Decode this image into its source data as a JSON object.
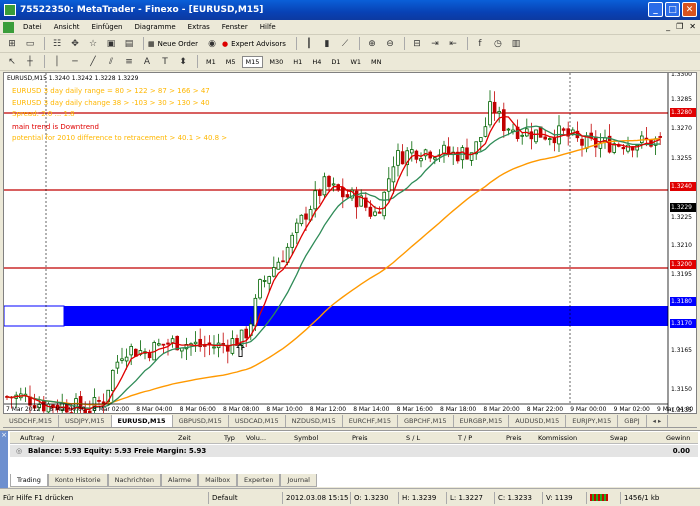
{
  "window": {
    "title": "75522350: MetaTrader - Finexo - [EURUSD,M15]"
  },
  "menu": [
    "Datei",
    "Ansicht",
    "Einfügen",
    "Diagramme",
    "Extras",
    "Fenster",
    "Hilfe"
  ],
  "toolbar": {
    "new_order": "Neue Order",
    "expert_advisors": "Expert Advisors"
  },
  "timeframes": [
    "M1",
    "M5",
    "M15",
    "M30",
    "H1",
    "H4",
    "D1",
    "W1",
    "MN"
  ],
  "active_timeframe": "M15",
  "chart": {
    "symbol_header": "EURUSD,M15  1.3240 1.3242 1.3228 1.3229",
    "info_lines": [
      {
        "text": "EURUSD 3 day daily range = 80 > 122 > 87 > 166 > 47",
        "color": "yellow"
      },
      {
        "text": "EURUSD 3 day daily change  38 > -103 > 30 > 130 > 40",
        "color": "yellow"
      },
      {
        "text": "Spread: 2.0 ... 1.8",
        "color": "yellow"
      },
      {
        "text": "main trend is Downtrend",
        "color": "red"
      },
      {
        "text": "potential for 2010 difference to retracement > 40.1 > 40.8 >",
        "color": "yellow"
      }
    ],
    "price_labels": [
      {
        "text": "1.3300",
        "style": "plain"
      },
      {
        "text": "1.3285",
        "style": "plain"
      },
      {
        "text": "1.3280",
        "style": "red"
      },
      {
        "text": "1.3270",
        "style": "plain"
      },
      {
        "text": "1.3255",
        "style": "plain"
      },
      {
        "text": "1.3240",
        "style": "red"
      },
      {
        "text": "1.3229",
        "style": "black"
      },
      {
        "text": "1.3225",
        "style": "plain"
      },
      {
        "text": "1.3210",
        "style": "plain"
      },
      {
        "text": "1.3200",
        "style": "red"
      },
      {
        "text": "1.3195",
        "style": "plain"
      },
      {
        "text": "1.3180",
        "style": "blue"
      },
      {
        "text": "1.3170",
        "style": "blue"
      },
      {
        "text": "1.3165",
        "style": "plain"
      },
      {
        "text": "1.3150",
        "style": "plain"
      },
      {
        "text": "1.3135",
        "style": "plain"
      }
    ],
    "time_labels": [
      "7 Mar 2012",
      "8 Mar 00:00",
      "8 Mar 02:00",
      "8 Mar 04:00",
      "8 Mar 06:00",
      "8 Mar 08:00",
      "8 Mar 10:00",
      "8 Mar 12:00",
      "8 Mar 14:00",
      "8 Mar 16:00",
      "8 Mar 18:00",
      "8 Mar 20:00",
      "8 Mar 22:00",
      "9 Mar 00:00",
      "9 Mar 02:00",
      "9 Mar 04:00"
    ],
    "up_color": "#006400",
    "down_color": "#c00000",
    "ma_fast_color": "#e00000",
    "ma_mid_color": "#2e8b57",
    "ma_slow_color": "#ff9900",
    "zone_color": "#0000ff",
    "arrow_glyph": "⇧"
  },
  "chart_tabs": [
    "USDCHF,M15",
    "USDJPY,M15",
    "EURUSD,M15",
    "GBPUSD,M15",
    "USDCAD,M15",
    "NZDUSD,M15",
    "EURCHF,M15",
    "GBPCHF,M15",
    "EURGBP,M15",
    "AUDUSD,M15",
    "EURJPY,M15",
    "GBPJ"
  ],
  "active_chart_tab": "EURUSD,M15",
  "terminal": {
    "side_label": "Terminal",
    "headers": [
      "Auftrag",
      "/",
      "Zeit",
      "Typ",
      "Volu...",
      "Symbol",
      "Preis",
      "S / L",
      "T / P",
      "Preis",
      "Kommission",
      "Swap",
      "Gewinn"
    ],
    "balance_line": "Balance: 5.93  Equity: 5.93  Freie Margin: 5.93",
    "balance_value": "0.00",
    "tabs": [
      "Trading",
      "Konto Historie",
      "Nachrichten",
      "Alarme",
      "Mailbox",
      "Experten",
      "Journal"
    ],
    "active_tab": "Trading"
  },
  "status": {
    "help": "Für Hilfe F1 drücken",
    "profile": "Default",
    "datetime": "2012.03.08 15:15",
    "open": "O: 1.3230",
    "high": "H: 1.3239",
    "low": "L: 1.3227",
    "close": "C: 1.3233",
    "volume": "V: 1139",
    "traffic": "1456/1 kb"
  }
}
